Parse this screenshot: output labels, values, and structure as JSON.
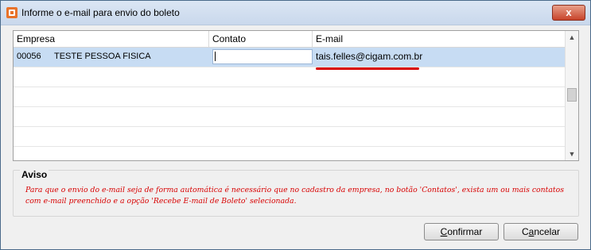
{
  "window": {
    "title": "Informe o e-mail para envio do boleto",
    "close_label": "x"
  },
  "grid": {
    "columns": [
      "Empresa",
      "Contato",
      "E-mail"
    ],
    "rows": [
      {
        "codigo": "00056",
        "empresa": "TESTE PESSOA FISICA",
        "contato": "",
        "email": "tais.felles@cigam.com.br"
      }
    ]
  },
  "aviso": {
    "title": "Aviso",
    "line1": "Para que o envio do e-mail seja de forma automática é necessário que no cadastro da empresa, no botão 'Contatos', exista um ou mais contatos",
    "line2": "com e-mail preenchido e a opção 'Recebe E-mail de Boleto' selecionada."
  },
  "buttons": {
    "confirm_first": "C",
    "confirm_rest": "onfirmar",
    "cancel_first": "C",
    "cancel_mid": "a",
    "cancel_rest": "ncelar"
  },
  "colors": {
    "accent_red": "#d80000",
    "selection": "#c7dcf3"
  }
}
